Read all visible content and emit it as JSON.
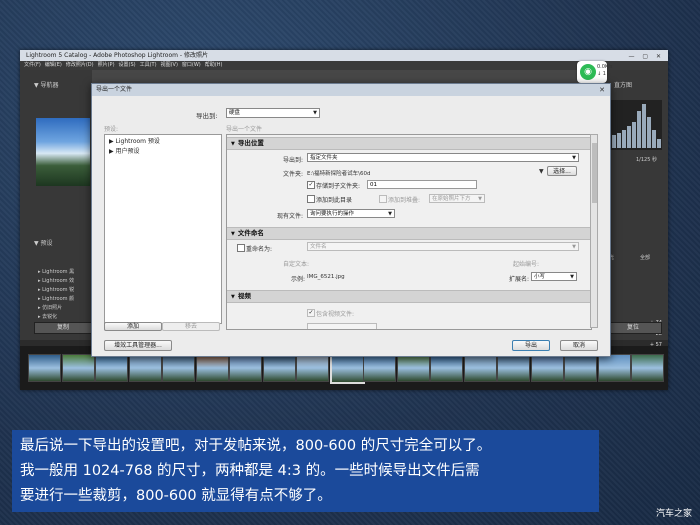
{
  "lightroom": {
    "window_title": "Lightroom 5 Catalog - Adobe Photoshop Lightroom - 修改照片",
    "window_buttons": "— ▢ ✕",
    "menu": [
      "文件(F)",
      "编辑(E)",
      "修改照片(D)",
      "照片(P)",
      "设置(S)",
      "工具(T)",
      "视图(V)",
      "窗口(W)",
      "帮助(H)"
    ],
    "navigator_label": "导航器",
    "presets_label": "预设",
    "presets": [
      "Lightroom 黑",
      "Lightroom 效",
      "Lightroom 锐",
      "Lightroom 颜",
      "仿旧照片",
      "去锐化",
      "越过程 1"
    ],
    "copy_button": "复制",
    "histogram_label": "直方图",
    "hist_values": [
      0.2,
      0.3,
      0.35,
      0.4,
      0.5,
      0.6,
      0.85,
      1.0,
      0.7,
      0.4,
      0.2
    ],
    "exposure_readout": "1/125 秒",
    "slider_values": [
      "+ 74",
      "− 28",
      "+ 57"
    ],
    "reset_button": "复位",
    "auto_label": "全部",
    "tone_label": "高光",
    "thumbnail_colors": [
      "#2f5d8a",
      "#4a7a3a",
      "#3a6fa0",
      "#6b8fb3",
      "#3c5c7c",
      "#8a5a3a",
      "#5a7aa8",
      "#2a4a6a",
      "#9aa8b8",
      "#2f5d8a",
      "#3b6b9b",
      "#507a40",
      "#2a5a8a",
      "#6a8aa8",
      "#3a5a7a",
      "#4f6f9f",
      "#2f4f6f",
      "#5f8fbf",
      "#3c6c4c"
    ],
    "selected_thumb": 9
  },
  "status_widget": {
    "speed_up": "0.0K/s",
    "speed_down": "↓ 1"
  },
  "dialog": {
    "title": "导出一个文件",
    "close_icon": "✕",
    "export_to_label": "导出到:",
    "export_to_value": "硬盘",
    "presets_label": "预设:",
    "presets_tree": [
      "Lightroom 预设",
      "用户预设"
    ],
    "add_button": "添加",
    "remove_button": "移去",
    "subtitle": "导出一个文件",
    "sec_location": "导出位置",
    "export_label": "导出到:",
    "export_value": "指定文件夹",
    "folder_label": "文件夹:",
    "folder_value": "E:\\福特新探险者试车\\60d",
    "choose_button": "选择...",
    "subfolder_label": "存储到子文件夹:",
    "subfolder_value": "01",
    "add_to_catalog": "添加到此目录",
    "add_to_stack": "添加到堆叠:",
    "stack_position": "在原始照片下方",
    "existing_label": "现有文件:",
    "existing_value": "询问要执行的操作",
    "sec_naming": "文件命名",
    "rename_label": "重命名为:",
    "rename_value": "文件名",
    "custom_text": "自定文本:",
    "start_number": "起始编号:",
    "example_label": "示例:",
    "example_value": "IMG_6521.jpg",
    "extension_label": "扩展名:",
    "extension_value": "小写",
    "sec_video": "视频",
    "include_video": "包含视频文件:",
    "plugin_button": "增效工具管理器...",
    "export_button": "导出",
    "cancel_button": "取消"
  },
  "caption": {
    "lines": [
      "最后说一下导出的设置吧，对于发帖来说，800-600 的尺寸完全可以了。",
      "我一般用 1024-768 的尺寸，两种都是 4:3 的。一些时候导出文件后需",
      "要进行一些裁剪，800-600 就显得有点不够了。"
    ],
    "brand_logo": "汽车之家"
  }
}
